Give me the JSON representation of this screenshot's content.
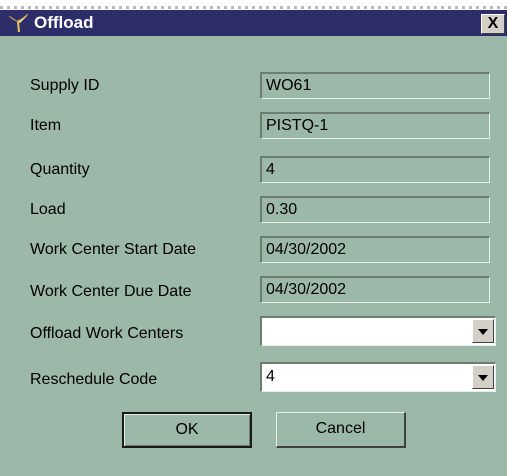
{
  "window": {
    "title": "Offload",
    "close_label": "X"
  },
  "fields": [
    {
      "label": "Supply ID",
      "value": "WO61"
    },
    {
      "label": "Item",
      "value": "PISTQ-1"
    },
    {
      "label": "Quantity",
      "value": "4"
    },
    {
      "label": "Load",
      "value": "0.30"
    },
    {
      "label": "Work Center Start Date",
      "value": "04/30/2002"
    },
    {
      "label": "Work Center Due Date",
      "value": "04/30/2002"
    }
  ],
  "offload_work_centers": {
    "label": "Offload Work Centers",
    "value": ""
  },
  "reschedule_code": {
    "label": "Reschedule Code",
    "value": "4"
  },
  "buttons": {
    "ok": "OK",
    "cancel": "Cancel"
  },
  "icons": {
    "title_icon": "offload-app-icon",
    "dropdown": "chevron-down-icon"
  }
}
